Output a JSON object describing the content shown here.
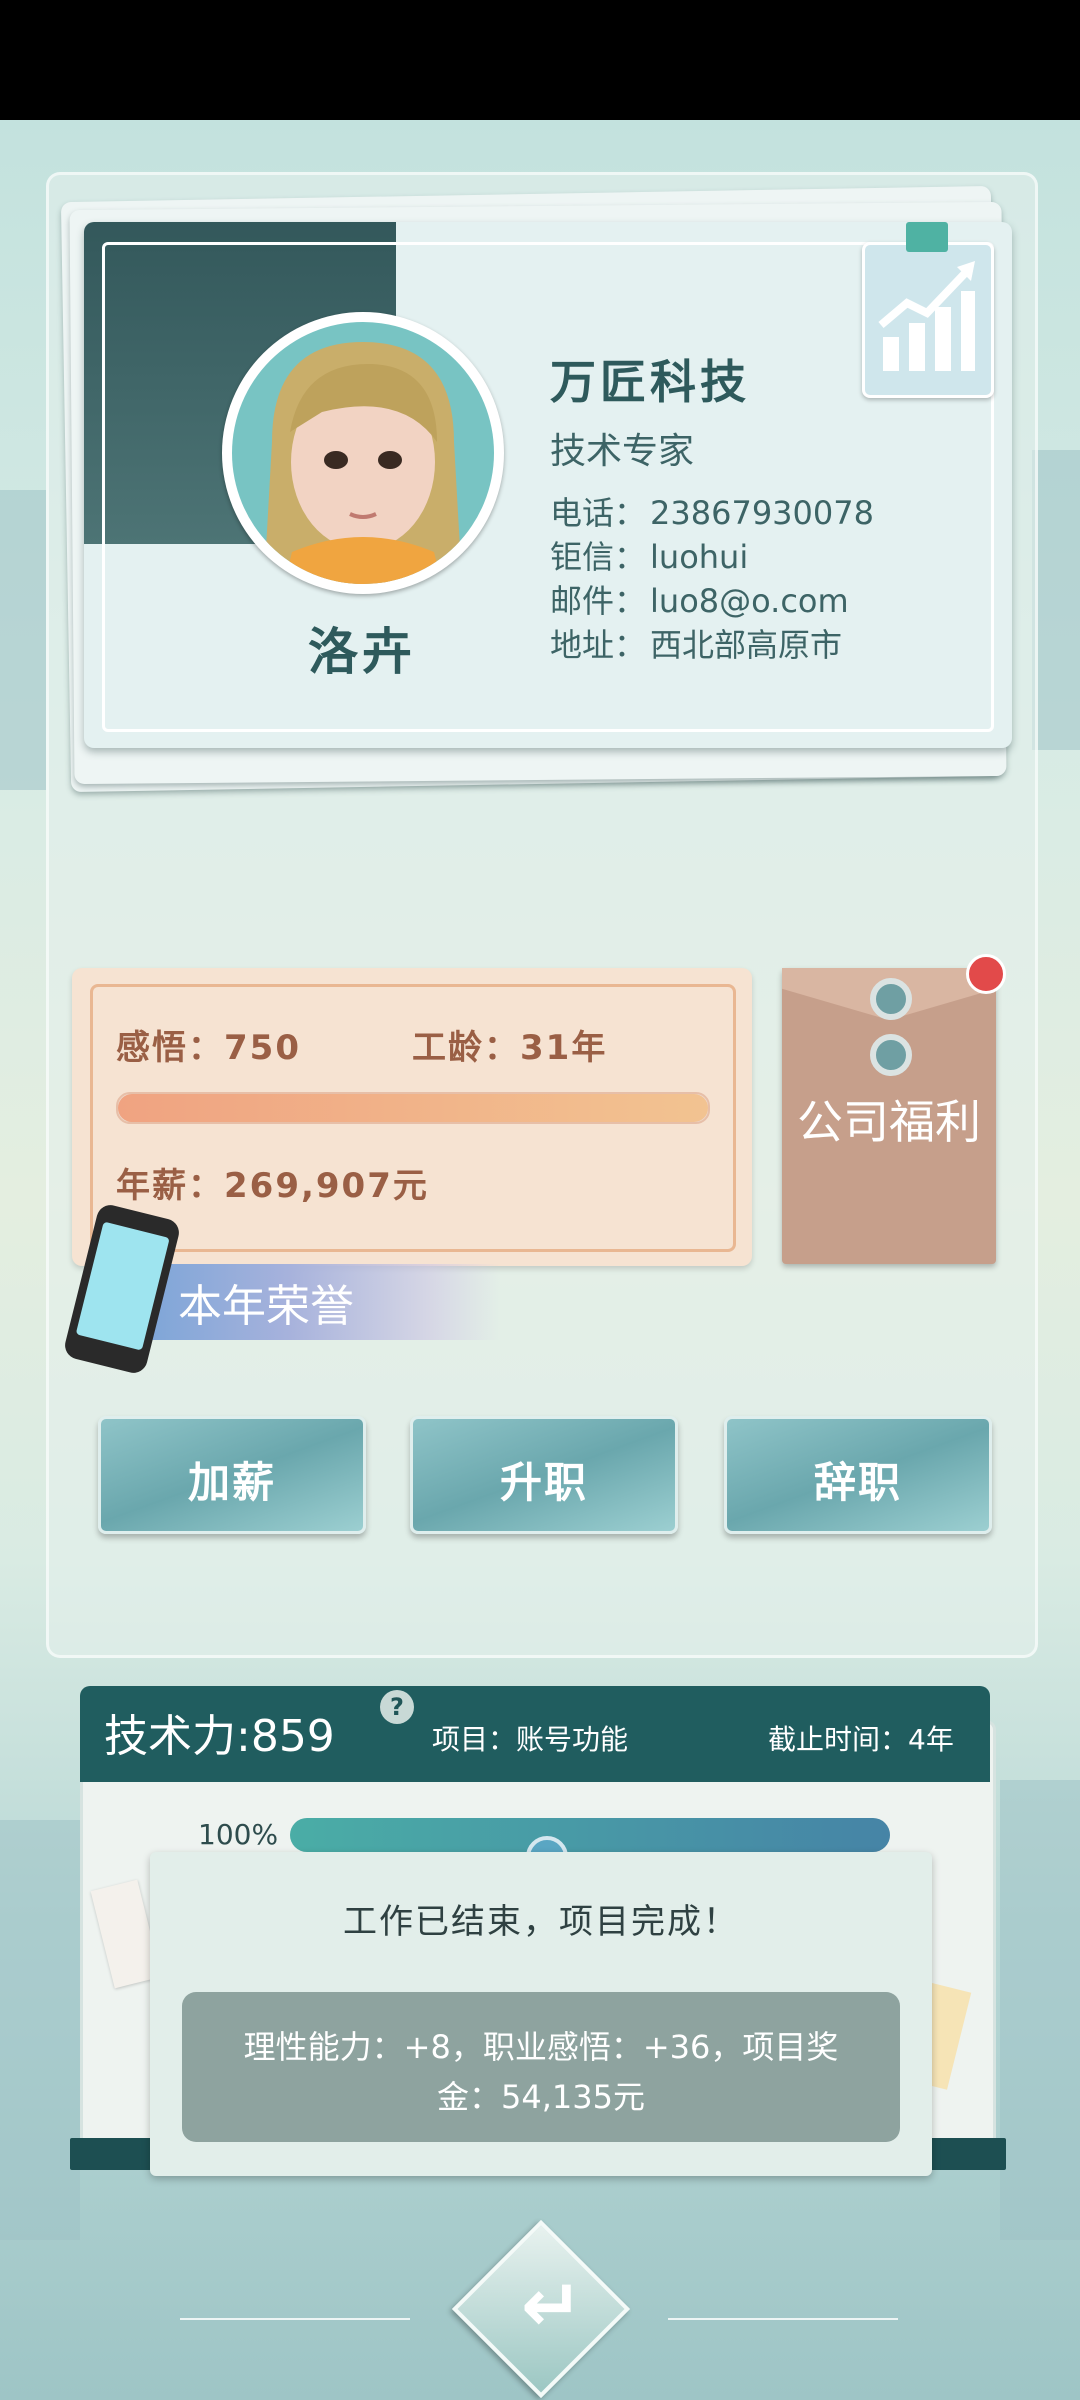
{
  "card": {
    "name": "洛卉",
    "company": "万匠科技",
    "title": "技术专家",
    "phone_label": "电话：",
    "phone": "23867930078",
    "ju_label": "钜信：",
    "ju": "luohui",
    "email_label": "邮件：",
    "email": "luo8@o.com",
    "address_label": "地址：",
    "address": "西北部高原市"
  },
  "stats": {
    "insight": "感悟：750",
    "seniority": "工龄：31年",
    "salary": "年薪：269,907元",
    "bar_fill_fraction": 1.0
  },
  "welfare": {
    "label": "公司福利",
    "has_notification": true
  },
  "honor": {
    "label": "本年荣誉"
  },
  "actions": {
    "raise": "加薪",
    "promote": "升职",
    "resign": "辞职"
  },
  "project": {
    "tech_power": "技术力:859",
    "help": "?",
    "name": "项目：账号功能",
    "deadline": "截止时间：4年",
    "progress_label": "100%",
    "progress_fraction": 1.0
  },
  "popup": {
    "title": "工作已结束，项目完成！",
    "message": "理性能力：+8，职业感悟：+36，项目奖金：54,135元"
  },
  "colors": {
    "accent_dark": "#205d5f",
    "card_text": "#2e5a5c",
    "stat_text": "#9a5f45",
    "notify": "#e24a4a"
  }
}
